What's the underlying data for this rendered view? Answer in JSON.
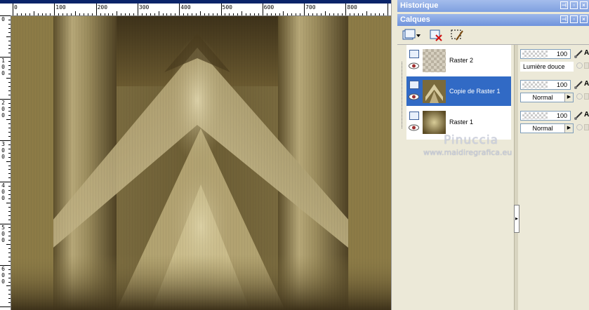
{
  "colors": {
    "titlebar": "#7fa0e0",
    "selection": "#316ac5",
    "panel_bg": "#ece9d8",
    "canvas_dark": "#3e321a",
    "canvas_mid": "#8c7d4e",
    "canvas_light": "#e6dcb4"
  },
  "ruler": {
    "h_labels": [
      "0",
      "100",
      "200",
      "300",
      "400",
      "500",
      "600",
      "700",
      "800"
    ],
    "v_labels": [
      [
        "0"
      ],
      [
        "1",
        "0",
        "0"
      ],
      [
        "2",
        "0",
        "0"
      ],
      [
        "3",
        "0",
        "0"
      ],
      [
        "4",
        "0",
        "0"
      ],
      [
        "5",
        "0",
        "0"
      ],
      [
        "6",
        "0",
        "0"
      ]
    ]
  },
  "panels": {
    "history_title": "Historique",
    "layers_title": "Calques",
    "title_buttons": [
      "pin-icon",
      "restore-icon",
      "close-icon"
    ]
  },
  "toolbar": {
    "icons": [
      "new-layer-icon",
      "delete-layer-icon",
      "edit-selection-icon"
    ]
  },
  "layers": [
    {
      "name": "Raster 2",
      "selected": false,
      "opacity": "100",
      "blend": "Lumière douce",
      "thumb": "transparent"
    },
    {
      "name": "Copie de Raster 1",
      "selected": true,
      "opacity": "100",
      "blend": "Normal",
      "thumb": "pattern"
    },
    {
      "name": "Raster 1",
      "selected": false,
      "opacity": "100",
      "blend": "Normal",
      "thumb": "gradient"
    }
  ],
  "props_label": "A",
  "watermark": {
    "name": "Pinuccia",
    "url": "www.maidiregrafica.eu"
  }
}
